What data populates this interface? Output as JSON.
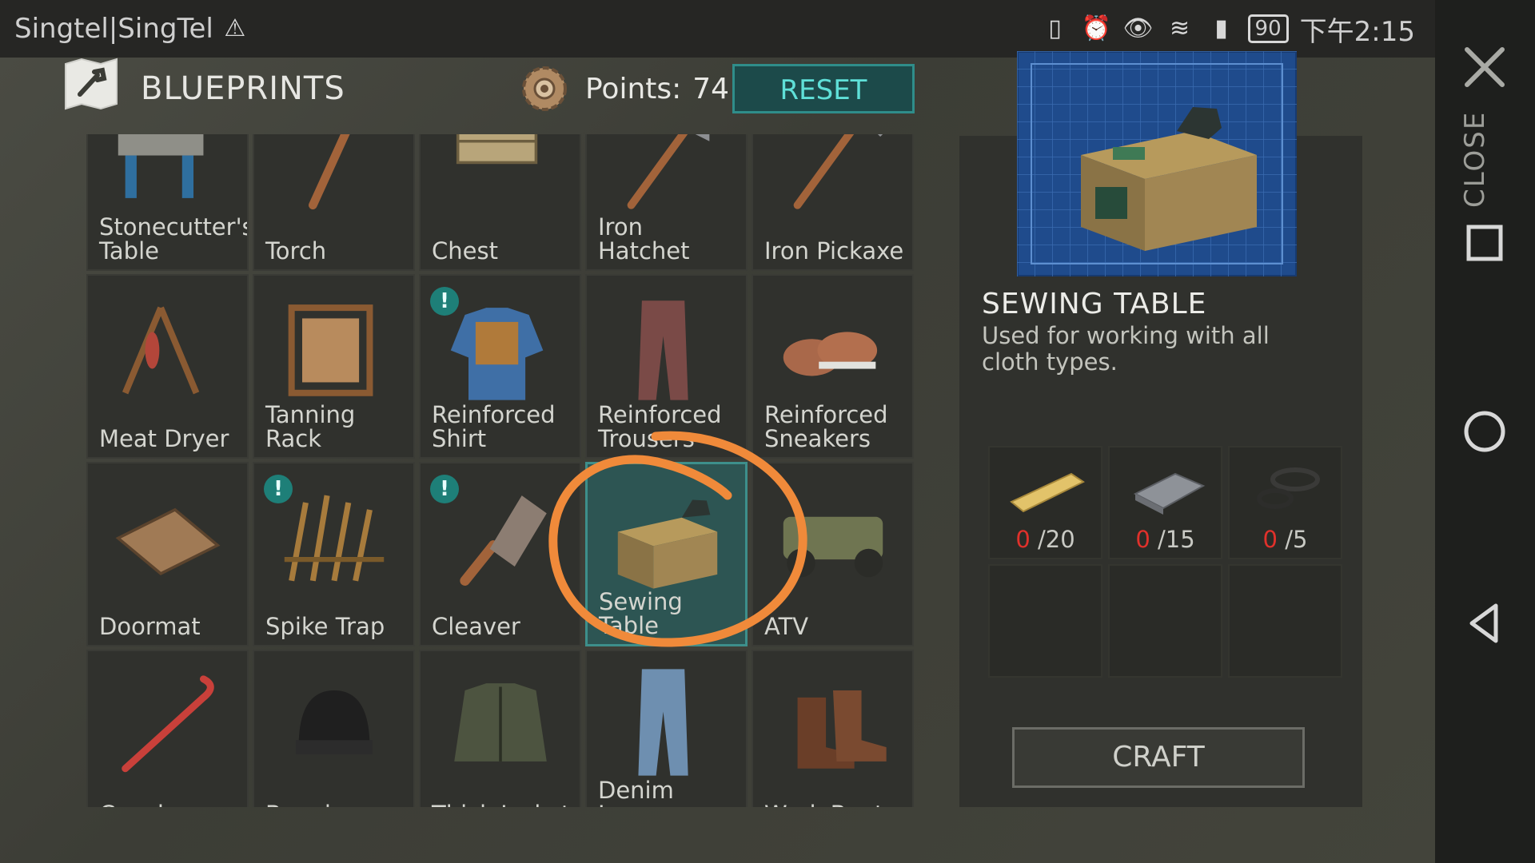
{
  "status_bar": {
    "carrier": "Singtel|SingTel",
    "battery": "90",
    "time": "下午2:15"
  },
  "header": {
    "title": "BLUEPRINTS",
    "points_label": "Points:",
    "points_value": "74",
    "reset_label": "RESET"
  },
  "nav": {
    "close_label": "CLOSE"
  },
  "grid": {
    "items": [
      {
        "label": "Stonecutter's Table",
        "icon": "stonecutter-table-icon"
      },
      {
        "label": "Torch",
        "icon": "torch-icon"
      },
      {
        "label": "Chest",
        "icon": "chest-icon"
      },
      {
        "label": "Iron Hatchet",
        "icon": "iron-hatchet-icon"
      },
      {
        "label": "Iron Pickaxe",
        "icon": "iron-pickaxe-icon"
      },
      {
        "label": "Meat Dryer",
        "icon": "meat-dryer-icon"
      },
      {
        "label": "Tanning Rack",
        "icon": "tanning-rack-icon"
      },
      {
        "label": "Reinforced Shirt",
        "icon": "reinforced-shirt-icon",
        "notice": true
      },
      {
        "label": "Reinforced Trousers",
        "icon": "reinforced-trousers-icon"
      },
      {
        "label": "Reinforced Sneakers",
        "icon": "reinforced-sneakers-icon"
      },
      {
        "label": "Doormat",
        "icon": "doormat-icon"
      },
      {
        "label": "Spike Trap",
        "icon": "spike-trap-icon",
        "notice": true
      },
      {
        "label": "Cleaver",
        "icon": "cleaver-icon",
        "notice": true
      },
      {
        "label": "Sewing Table",
        "icon": "sewing-table-icon",
        "selected": true
      },
      {
        "label": "ATV",
        "icon": "atv-icon"
      },
      {
        "label": "Crowbar",
        "icon": "crowbar-icon"
      },
      {
        "label": "Beanie",
        "icon": "beanie-icon"
      },
      {
        "label": "Thick Jacket",
        "icon": "thick-jacket-icon"
      },
      {
        "label": "Denim Jeans",
        "icon": "denim-jeans-icon"
      },
      {
        "label": "Work Boots",
        "icon": "work-boots-icon"
      }
    ],
    "notice_glyph": "!"
  },
  "detail": {
    "title": "SEWING TABLE",
    "description": "Used for working with all cloth types.",
    "requirements": [
      {
        "icon": "wood-plank-icon",
        "have": "0",
        "need": "/20"
      },
      {
        "icon": "iron-ingot-icon",
        "have": "0",
        "need": "/15"
      },
      {
        "icon": "thread-coil-icon",
        "have": "0",
        "need": "/5"
      }
    ],
    "craft_label": "CRAFT"
  },
  "colors": {
    "accent": "#2f8d8a",
    "missing": "#e0312b",
    "annotation": "#f08a3a"
  }
}
